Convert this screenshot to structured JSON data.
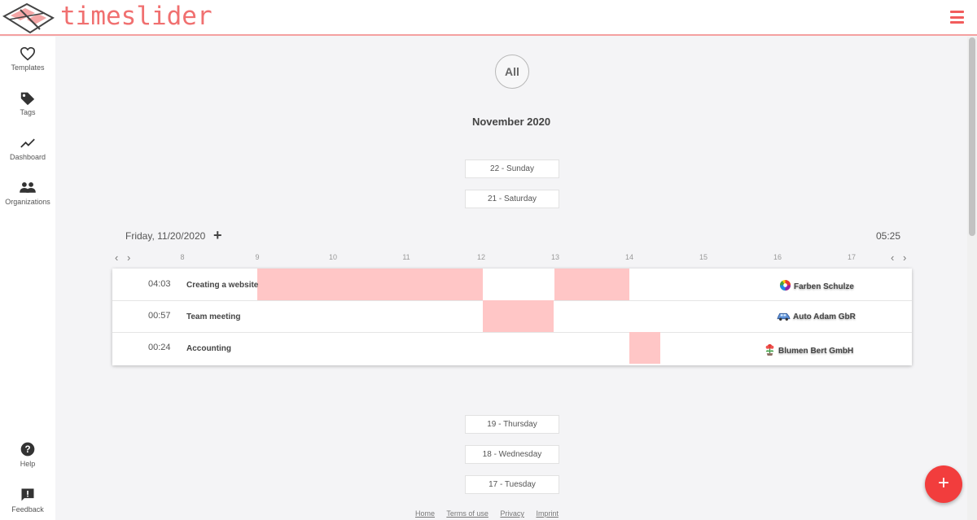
{
  "app": {
    "brand": "timeslider"
  },
  "sidebar": {
    "items": [
      {
        "label": "Templates",
        "icon": "heart-icon"
      },
      {
        "label": "Tags",
        "icon": "tag-icon"
      },
      {
        "label": "Dashboard",
        "icon": "trend-icon"
      },
      {
        "label": "Organizations",
        "icon": "people-icon"
      }
    ],
    "bottom": [
      {
        "label": "Help",
        "icon": "help-icon"
      },
      {
        "label": "Feedback",
        "icon": "feedback-icon"
      }
    ]
  },
  "filter": {
    "all_label": "All"
  },
  "month": "November 2020",
  "days_before": [
    "22 - Sunday",
    "21 - Saturday"
  ],
  "current_day": {
    "date": "Friday, 11/20/2020",
    "add": "+",
    "total": "05:25"
  },
  "hours": [
    "8",
    "9",
    "10",
    "11",
    "12",
    "13",
    "14",
    "15",
    "16",
    "17"
  ],
  "entries": [
    {
      "duration": "04:03",
      "task": "Creating a website",
      "client": "Farben Schulze",
      "client_icon": "color-wheel-icon"
    },
    {
      "duration": "00:57",
      "task": "Team meeting",
      "client": "Auto Adam GbR",
      "client_icon": "car-icon"
    },
    {
      "duration": "00:24",
      "task": "Accounting",
      "client": "Blumen Bert GmbH",
      "client_icon": "flower-icon"
    }
  ],
  "days_after": [
    "19 - Thursday",
    "18 - Wednesday",
    "17 - Tuesday"
  ],
  "footer": {
    "home": "Home",
    "terms": "Terms of use",
    "privacy": "Privacy",
    "imprint": "Imprint"
  },
  "colors": {
    "accent": "#f25c5c",
    "block": "#ffc6c6",
    "fab": "#f23d3d"
  }
}
